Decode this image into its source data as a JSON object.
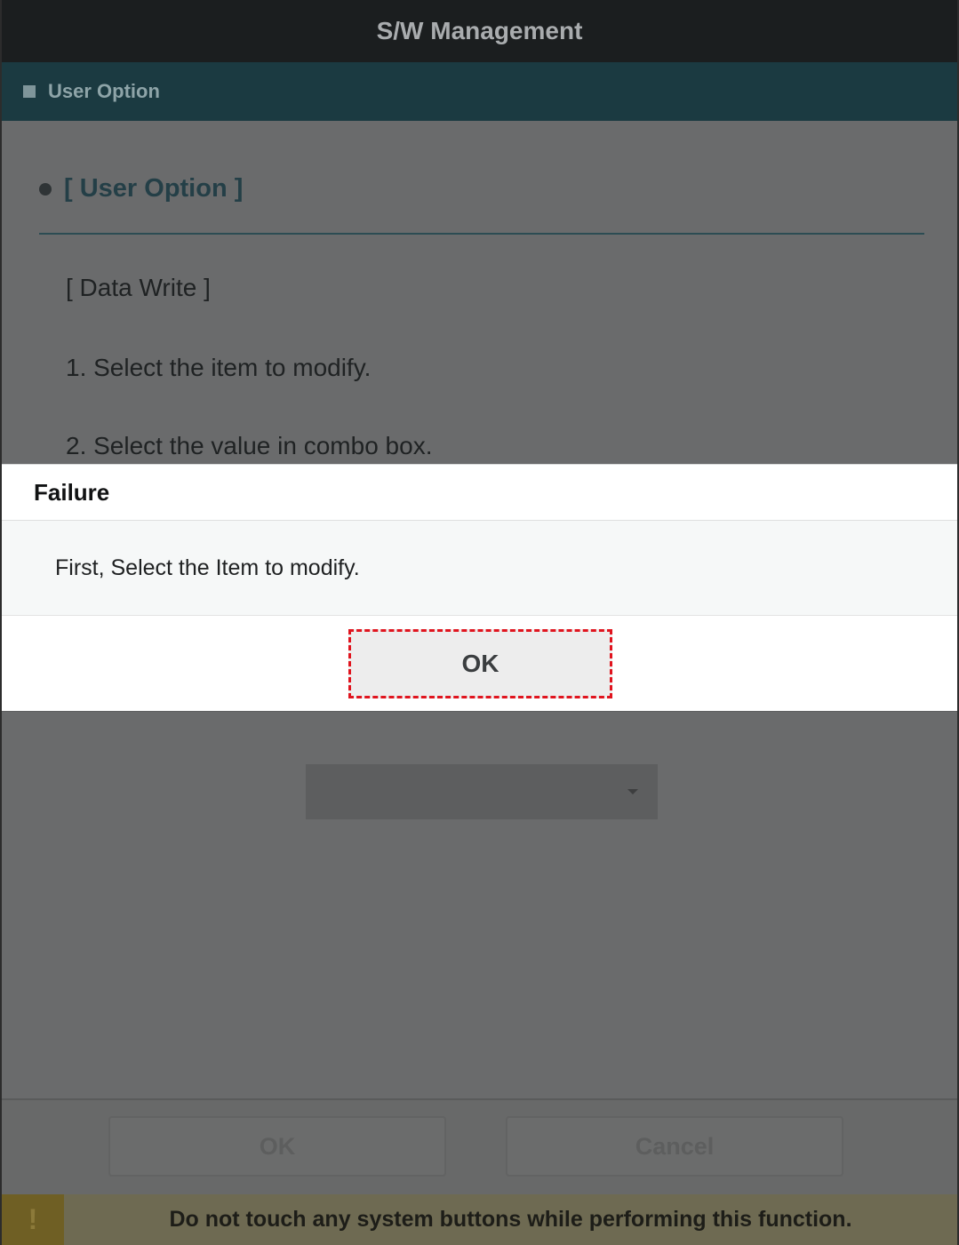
{
  "app": {
    "title": "S/W Management"
  },
  "section": {
    "title": "User Option",
    "icon": "square-icon"
  },
  "content": {
    "heading": "[ User Option ]",
    "subheading": "[ Data Write ]",
    "steps": [
      "1. Select the item to modify.",
      "2. Select the value in combo box."
    ],
    "combo_value": ""
  },
  "footer": {
    "ok_label": "OK",
    "cancel_label": "Cancel"
  },
  "warning": {
    "icon_glyph": "!",
    "text": "Do not touch any system buttons while performing this function."
  },
  "dialog": {
    "title": "Failure",
    "message": "First, Select the Item to modify.",
    "ok_label": "OK"
  },
  "colors": {
    "highlight": "#e0141e",
    "header_bar": "#1b1e1f",
    "section_bar": "#1b3a41",
    "warning_bar": "#6e6a52"
  }
}
